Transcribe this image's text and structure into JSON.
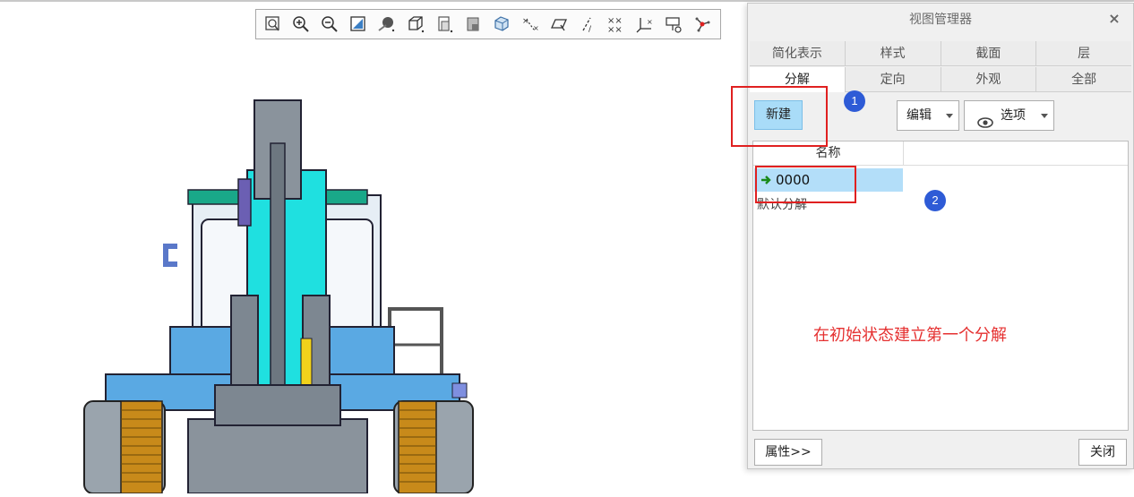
{
  "toolbar": {
    "buttons": [
      {
        "name": "refit-icon"
      },
      {
        "name": "zoom-in-icon"
      },
      {
        "name": "zoom-out-icon"
      },
      {
        "name": "repaint-icon"
      },
      {
        "name": "display-style-icon"
      },
      {
        "name": "saved-orientations-icon"
      },
      {
        "name": "view-manager-icon"
      },
      {
        "name": "perspective-view-icon"
      },
      {
        "name": "section-view-icon"
      },
      {
        "name": "datum-display-icon"
      },
      {
        "name": "plane-display-icon"
      },
      {
        "name": "axis-display-icon"
      },
      {
        "name": "point-display-icon"
      },
      {
        "name": "csys-display-icon"
      },
      {
        "name": "annotation-display-icon"
      },
      {
        "name": "spin-center-icon"
      }
    ]
  },
  "dialog": {
    "title": "视图管理器",
    "close_glyph": "×",
    "tabs_row1": [
      "简化表示",
      "样式",
      "截面",
      "层"
    ],
    "tabs_row2": [
      "分解",
      "定向",
      "外观",
      "全部"
    ],
    "selected_tab": "分解",
    "new_button": "新建",
    "edit_button": "编辑",
    "options_button": "选项",
    "list": {
      "column_header": "名称",
      "rows": [
        {
          "label": "0000",
          "selected": true
        }
      ],
      "subtitle": "默认分解"
    },
    "properties_button": "属性>>",
    "close_button": "关闭"
  },
  "annotations": {
    "badge1": "1",
    "badge2": "2",
    "note": "在初始状态建立第一个分解",
    "note_color": "#e53030",
    "box_color": "#e02020",
    "badge_color": "#2e5bd6"
  },
  "colors": {
    "selection": "#b3def9",
    "new_button": "#a9dcf8"
  }
}
